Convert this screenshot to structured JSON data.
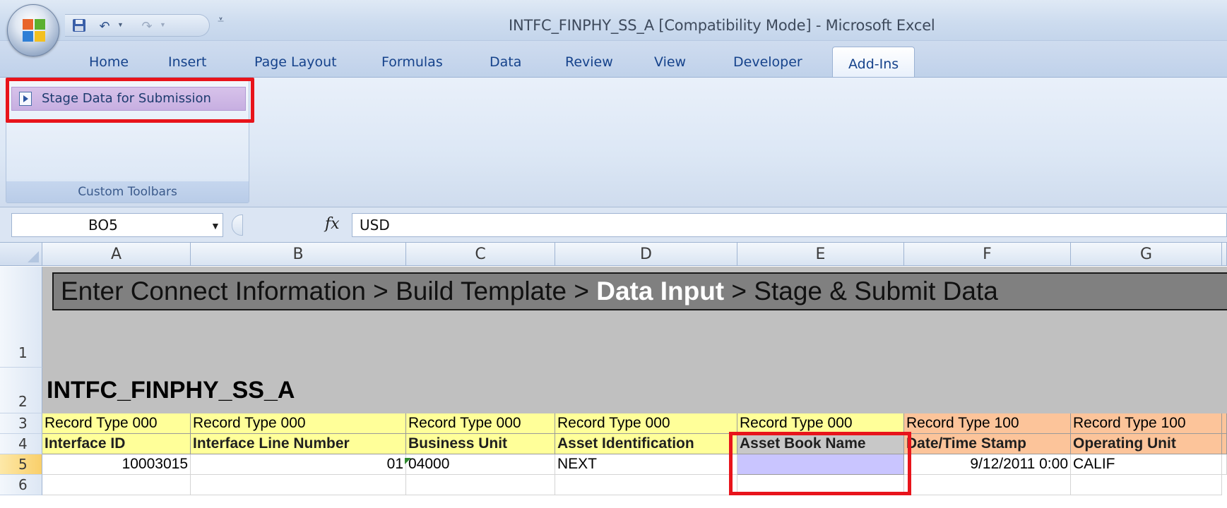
{
  "window": {
    "title": "INTFC_FINPHY_SS_A  [Compatibility Mode] - Microsoft Excel"
  },
  "quick_access": {
    "icons": [
      "save-icon",
      "undo-icon",
      "redo-icon",
      "customize-qat-icon"
    ]
  },
  "ribbon": {
    "tabs": [
      {
        "label": "Home"
      },
      {
        "label": "Insert"
      },
      {
        "label": "Page Layout"
      },
      {
        "label": "Formulas"
      },
      {
        "label": "Data"
      },
      {
        "label": "Review"
      },
      {
        "label": "View"
      },
      {
        "label": "Developer"
      },
      {
        "label": "Add-Ins",
        "active": true
      }
    ],
    "group": {
      "button_label": "Stage Data for Submission",
      "label": "Custom Toolbars"
    }
  },
  "formula_bar": {
    "name_box": "BO5",
    "fx": "fx",
    "value": "USD"
  },
  "grid": {
    "columns": [
      "A",
      "B",
      "C",
      "D",
      "E",
      "F",
      "G"
    ],
    "rows": [
      "1",
      "2",
      "3",
      "4",
      "5",
      "6"
    ],
    "breadcrumb": {
      "before": "Enter Connect Information > Build Template > ",
      "current": "Data Input",
      "after": " > Stage & Submit Data"
    },
    "sheet_title": "INTFC_FINPHY_SS_A",
    "record_types": [
      "Record Type 000",
      "Record Type 000",
      "Record Type 000",
      "Record Type 000",
      "Record Type 000",
      "Record Type 100",
      "Record Type 100"
    ],
    "field_names": [
      "Interface ID",
      "Interface Line Number",
      "Business Unit",
      "Asset Identification",
      "Asset Book Name",
      "Date/Time Stamp",
      "Operating Unit"
    ],
    "data_row": [
      "10003015",
      "01",
      "04000",
      "NEXT",
      "",
      "9/12/2011 0:00",
      "CALIF"
    ]
  },
  "colors": {
    "record_type_000": "#ffff99",
    "record_type_100": "#fcc49a",
    "highlight": "#e8141b",
    "selected_cell": "#c9c5ff"
  }
}
